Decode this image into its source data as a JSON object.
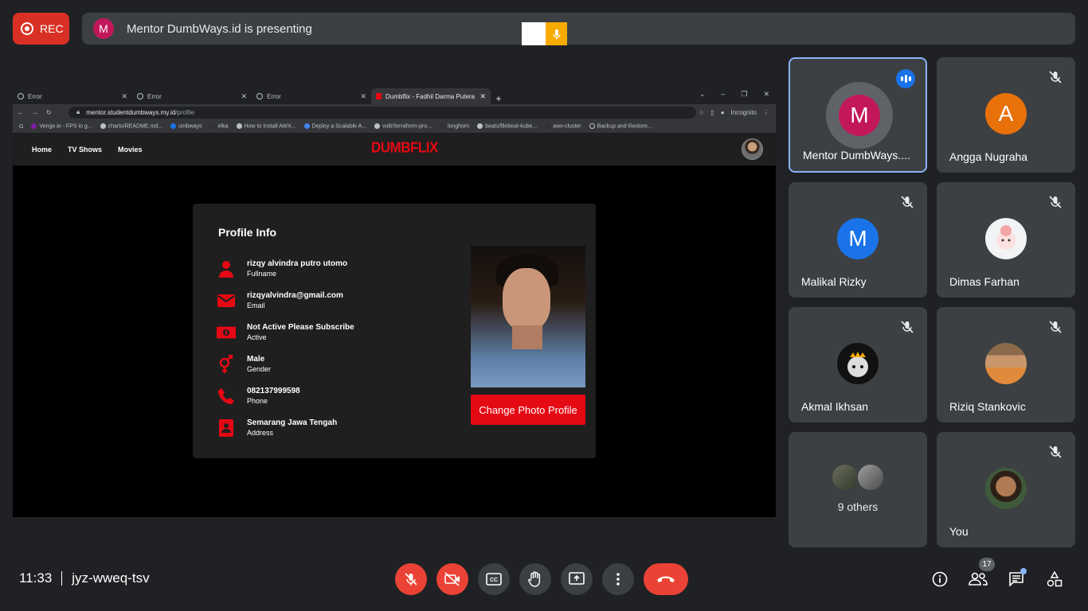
{
  "rec_label": "REC",
  "presenting": {
    "avatar_letter": "M",
    "text": "Mentor DumbWays.id is presenting"
  },
  "browser": {
    "tabs": [
      {
        "title": "Error",
        "active": false
      },
      {
        "title": "Error",
        "active": false
      },
      {
        "title": "Error",
        "active": false
      },
      {
        "title": "Dumbflix - Fadhil Darma Putera",
        "active": true
      }
    ],
    "new_tab": "+",
    "url_host": "mentor.studentdumbways.my.id",
    "url_path": "/profile",
    "incognito": "Incognito",
    "bookmarks": [
      "Venge.io - FPS io g...",
      "charts/README.md...",
      "umbways",
      "elka",
      "How to Install AWX...",
      "Deploy a Scalable A...",
      "vultr/terraform-pro...",
      "longhorn",
      "beats/filebeat-kube...",
      "awx-cluster",
      "Backup and Restore..."
    ]
  },
  "site": {
    "nav": [
      "Home",
      "TV Shows",
      "Movies"
    ],
    "logo": "DUMBFLIX",
    "profile": {
      "title": "Profile Info",
      "rows": [
        {
          "icon": "user-icon",
          "value": "rizqy alvindra putro utomo",
          "label": "Fullname"
        },
        {
          "icon": "mail-icon",
          "value": "rizqyalvindra@gmail.com",
          "label": "Email"
        },
        {
          "icon": "money-icon",
          "value": "Not Active Please Subscribe",
          "label": "Active"
        },
        {
          "icon": "gender-icon",
          "value": "Male",
          "label": "Gender"
        },
        {
          "icon": "phone-icon",
          "value": "082137999598",
          "label": "Phone"
        },
        {
          "icon": "address-icon",
          "value": "Semarang Jawa Tengah",
          "label": "Address"
        }
      ],
      "change_photo": "Change Photo Profile"
    }
  },
  "participants": [
    {
      "name": "Mentor DumbWays....",
      "letter": "M",
      "color": "#c2185b",
      "speaking": true
    },
    {
      "name": "Angga Nugraha",
      "letter": "A",
      "color": "#e8710a",
      "muted": true
    },
    {
      "name": "Malikal Rizky",
      "letter": "M",
      "color": "#1a73e8",
      "muted": true
    },
    {
      "name": "Dimas Farhan",
      "letter": "",
      "color": "#f1f3f4",
      "muted": true
    },
    {
      "name": "Akmal Ikhsan",
      "letter": "",
      "color": "#111111",
      "muted": true
    },
    {
      "name": "Riziq Stankovic",
      "letter": "",
      "color": "#c9966b",
      "muted": true
    },
    {
      "name": "",
      "others": "9 others"
    },
    {
      "name": "You",
      "letter": "",
      "color": "#5a4632",
      "muted": true
    }
  ],
  "meeting": {
    "time": "11:33",
    "code": "jyz-wweq-tsv",
    "people_count": "17"
  },
  "colors": {
    "accent_red": "#ea4335",
    "brand_red": "#e50914",
    "speaking_blue": "#1a73e8"
  }
}
